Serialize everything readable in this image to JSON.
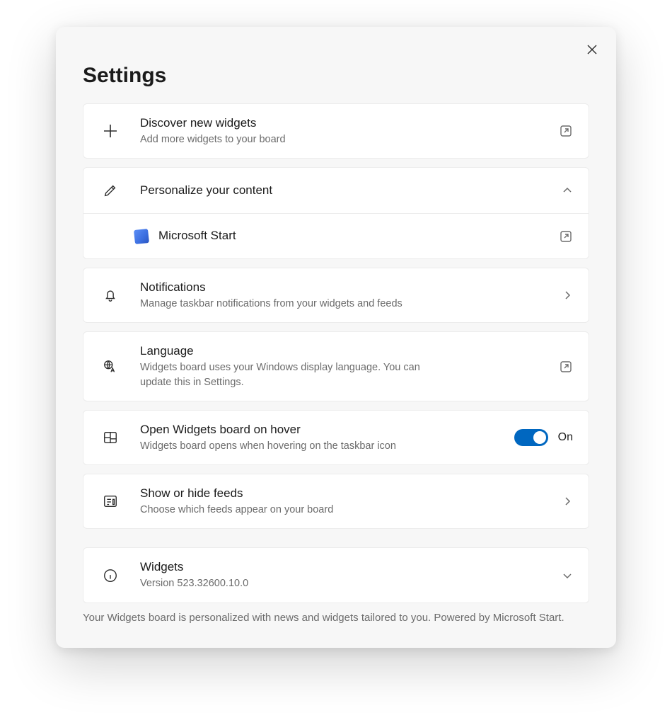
{
  "title": "Settings",
  "items": {
    "discover": {
      "title": "Discover new widgets",
      "sub": "Add more widgets to your board"
    },
    "personalize": {
      "title": "Personalize your content",
      "child": "Microsoft Start"
    },
    "notifications": {
      "title": "Notifications",
      "sub": "Manage taskbar notifications from your widgets and feeds"
    },
    "language": {
      "title": "Language",
      "sub": "Widgets board uses your Windows display language. You can update this in Settings."
    },
    "hover": {
      "title": "Open Widgets board on hover",
      "sub": "Widgets board opens when hovering on the taskbar icon",
      "state": "On"
    },
    "feeds": {
      "title": "Show or hide feeds",
      "sub": "Choose which feeds appear on your board"
    },
    "about": {
      "title": "Widgets",
      "sub": "Version 523.32600.10.0"
    }
  },
  "footer": "Your Widgets board is personalized with news and widgets tailored to you. Powered by Microsoft Start."
}
